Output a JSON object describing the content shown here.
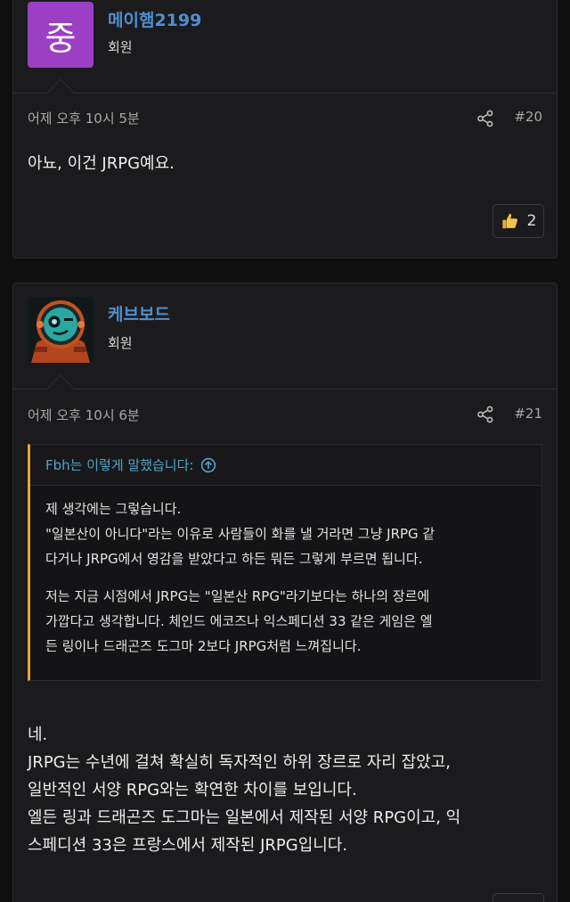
{
  "posts": [
    {
      "avatar_letter": "중",
      "username": "메이햄2199",
      "user_title": "회원",
      "date": "어제 오후 10시 5분",
      "post_number": "#20",
      "body": "아뇨, 이건 JRPG예요.",
      "reaction_count": "2",
      "reaction_icon": "thumbs-up-icon"
    },
    {
      "avatar_icon": "robot-astronaut-avatar",
      "username": "케브보드",
      "user_title": "회원",
      "date": "어제 오후 10시 6분",
      "post_number": "#21",
      "quote": {
        "attribution": "Fbh는 이렇게 말했습니다:",
        "paragraph1_lines": [
          "제 생각에는 그렇습니다.",
          "\"일본산이 아니다\"라는 이유로 사람들이 화를 낼 거라면 그냥 JRPG 같",
          "다거나 JRPG에서 영감을 받았다고 하든 뭐든 그렇게 부르면 됩니다."
        ],
        "paragraph2_lines": [
          "저는 지금 시점에서 JRPG는 \"일본산 RPG\"라기보다는 하나의 장르에",
          "가깝다고 생각합니다. 체인드 에코즈나 익스페디션 33 같은 게임은 엘",
          "든 링이나 드래곤즈 도그마 2보다 JRPG처럼 느껴집니다."
        ]
      },
      "body_lines": [
        "네.",
        "JRPG는 수년에 걸쳐 확실히 독자적인 하위 장르로 자리 잡았고,",
        "일반적인 서양 RPG와는 확연한 차이를 보입니다.",
        "엘든 링과 드래곤즈 도그마는 일본에서 제작된 서양 RPG이고, 익",
        "스페디션 33은 프랑스에서 제작된 JRPG입니다."
      ]
    }
  ],
  "colors": {
    "background": "#0f0f10",
    "panel": "#1b1b1d",
    "username": "#4f8fcf",
    "quote_accent": "#e8a33c",
    "quote_attribution": "#4fa3c9",
    "avatar_purple": "#9b3fc4"
  }
}
